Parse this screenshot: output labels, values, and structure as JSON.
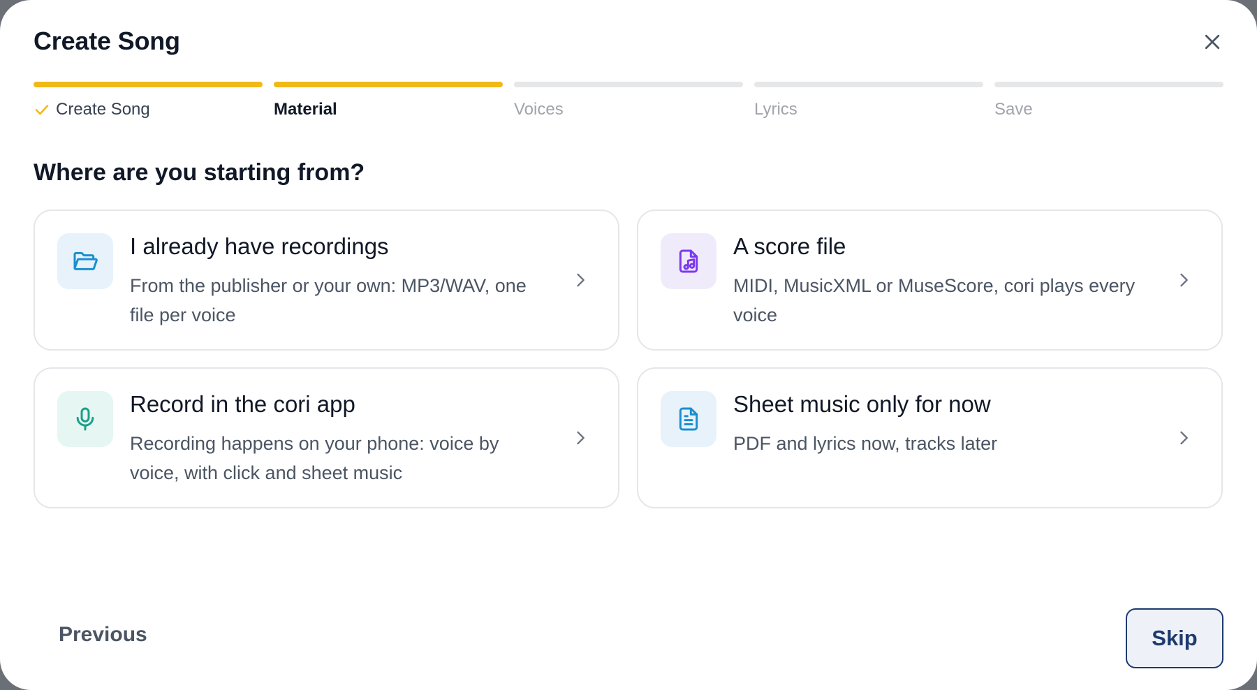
{
  "dialog": {
    "title": "Create Song",
    "close_icon": "close-icon"
  },
  "stepper": {
    "steps": [
      {
        "label": "Create Song",
        "state": "completed",
        "icon": "check-icon"
      },
      {
        "label": "Material",
        "state": "active"
      },
      {
        "label": "Voices",
        "state": "upcoming"
      },
      {
        "label": "Lyrics",
        "state": "upcoming"
      },
      {
        "label": "Save",
        "state": "upcoming"
      }
    ],
    "accent_color": "#f2b916"
  },
  "question": "Where are you starting from?",
  "options": [
    {
      "title": "I already have recordings",
      "description": "From the publisher or your own: MP3/WAV, one file per voice",
      "icon": "folder-open-icon",
      "icon_color": "#1a8fcf",
      "icon_bg": "#e7f2fb"
    },
    {
      "title": "A score file",
      "description": "MIDI, MusicXML or MuseScore, cori plays every voice",
      "icon": "music-file-icon",
      "icon_color": "#7c3aed",
      "icon_bg": "#f0ebfa"
    },
    {
      "title": "Record in the cori app",
      "description": "Recording happens on your phone: voice by voice, with click and sheet music",
      "icon": "microphone-icon",
      "icon_color": "#1aa08a",
      "icon_bg": "#e6f6f2"
    },
    {
      "title": "Sheet music only for now",
      "description": "PDF and lyrics now, tracks later",
      "icon": "document-icon",
      "icon_color": "#1a8fcf",
      "icon_bg": "#e7f2fb"
    }
  ],
  "footer": {
    "previous_label": "Previous",
    "skip_label": "Skip"
  }
}
